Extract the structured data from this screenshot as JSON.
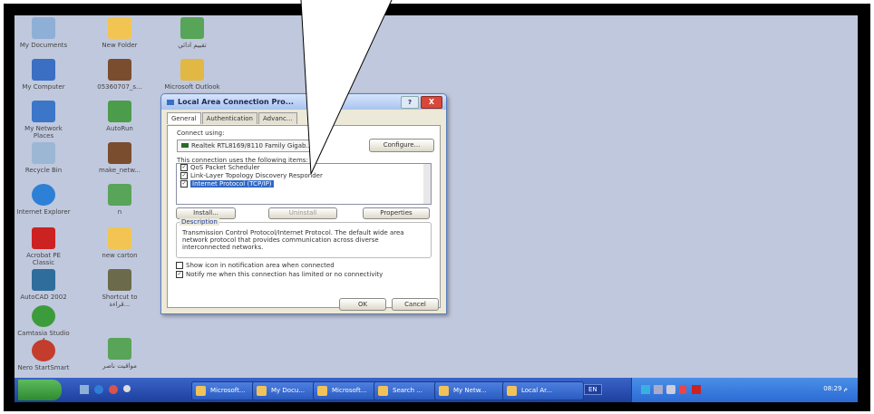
{
  "desktop_icons": [
    {
      "label": "My Documents",
      "color": "#8fb0d6"
    },
    {
      "label": "New Folder",
      "color": "#f2c553"
    },
    {
      "label": "تقييم ادائي",
      "color": "#58a458"
    },
    {
      "label": "My Computer",
      "color": "#3a6fc4"
    },
    {
      "label": "05360707_s...",
      "color": "#7a4d2e"
    },
    {
      "label": "Microsoft Outlook",
      "color": "#e2b844"
    },
    {
      "label": "My Network Places",
      "color": "#3b76c8"
    },
    {
      "label": "AutoRun",
      "color": "#4b9c4b"
    },
    {
      "label": "Recycle Bin",
      "color": "#9bb7d4"
    },
    {
      "label": "make_netw...",
      "color": "#7a4d2e"
    },
    {
      "label": "Internet Explorer",
      "color": "#2e80d6"
    },
    {
      "label": "n",
      "color": "#58a458"
    },
    {
      "label": "Acrobat PE Classic",
      "color": "#cc2222"
    },
    {
      "label": "new carton",
      "color": "#f2c553"
    },
    {
      "label": "AutoCAD 2002",
      "color": "#2f6d9c"
    },
    {
      "label": "Shortcut to قراءة...",
      "color": "#6b6b4b"
    },
    {
      "label": "Camtasia Studio 4",
      "color": "#3c9c3c"
    },
    {
      "label": "Nero StartSmart",
      "color": "#c43c2c"
    },
    {
      "label": "مواقيت ناصر",
      "color": "#58a458"
    }
  ],
  "dialog": {
    "title": "Local Area Connection Pro...",
    "help": "?",
    "close": "X",
    "tabs": [
      "General",
      "Authentication",
      "Advanc..."
    ],
    "connect_using_label": "Connect using:",
    "adapter": "Realtek RTL8169/8110 Family Gigab...",
    "configure": "Configure...",
    "items_label": "This connection uses the following items:",
    "items": [
      {
        "label": "QoS Packet Scheduler",
        "checked": true,
        "selected": false
      },
      {
        "label": "Link-Layer Topology Discovery Responder",
        "checked": true,
        "selected": false
      },
      {
        "label": "Internet Protocol (TCP/IP)",
        "checked": true,
        "selected": true
      }
    ],
    "install": "Install...",
    "uninstall": "Uninstall",
    "properties": "Properties",
    "description_label": "Description",
    "description": "Transmission Control Protocol/Internet Protocol. The default wide area network protocol that provides communication across diverse interconnected networks.",
    "show_icon": "Show icon in notification area when connected",
    "show_icon_checked": false,
    "notify": "Notify me when this connection has limited or no connectivity",
    "notify_checked": true,
    "ok": "OK",
    "cancel": "Cancel"
  },
  "taskbar": {
    "items": [
      "Microsoft...",
      "My Docu...",
      "Microsoft...",
      "Search ...",
      "My Netw...",
      "Local Ar..."
    ],
    "lang": "EN",
    "clock": "08:29 م"
  }
}
